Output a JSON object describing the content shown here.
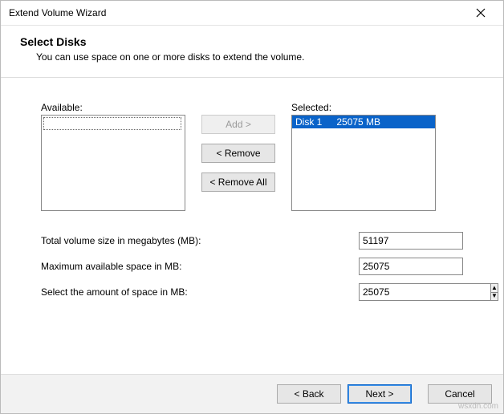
{
  "window": {
    "title": "Extend Volume Wizard"
  },
  "heading": {
    "title": "Select Disks",
    "subtitle": "You can use space on one or more disks to extend the volume."
  },
  "lists": {
    "available_label": "Available:",
    "selected_label": "Selected:",
    "selected_items": [
      {
        "name": "Disk 1",
        "size": "25075 MB"
      }
    ]
  },
  "buttons": {
    "add": "Add >",
    "remove": "< Remove",
    "remove_all": "< Remove All",
    "back": "< Back",
    "next": "Next >",
    "cancel": "Cancel"
  },
  "fields": {
    "total_label": "Total volume size in megabytes (MB):",
    "total_value": "51197",
    "max_label": "Maximum available space in MB:",
    "max_value": "25075",
    "select_label": "Select the amount of space in MB:",
    "select_value": "25075"
  },
  "watermark": "wsxdn.com"
}
